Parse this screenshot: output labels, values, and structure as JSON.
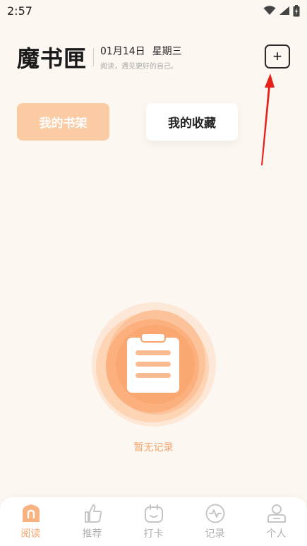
{
  "status_bar": {
    "time": "2:57"
  },
  "header": {
    "logo": "魔书匣",
    "date": "01月14日",
    "weekday": "星期三",
    "slogan": "阅读，遇见更好的自己。",
    "add_label": "+"
  },
  "tabs": [
    {
      "label": "我的书架",
      "active": true
    },
    {
      "label": "我的收藏",
      "active": false
    }
  ],
  "empty_state": {
    "text": "暂无记录"
  },
  "bottom_nav": [
    {
      "label": "阅读",
      "icon": "home-icon",
      "active": true
    },
    {
      "label": "推荐",
      "icon": "thumbs-up-icon",
      "active": false
    },
    {
      "label": "打卡",
      "icon": "calendar-icon",
      "active": false
    },
    {
      "label": "记录",
      "icon": "pulse-icon",
      "active": false
    },
    {
      "label": "个人",
      "icon": "person-icon",
      "active": false
    }
  ],
  "colors": {
    "accent": "#f3a56b",
    "tab_active_bg": "#fbcba3",
    "background": "#fdf7f2",
    "annotation_arrow": "#e8201a"
  }
}
